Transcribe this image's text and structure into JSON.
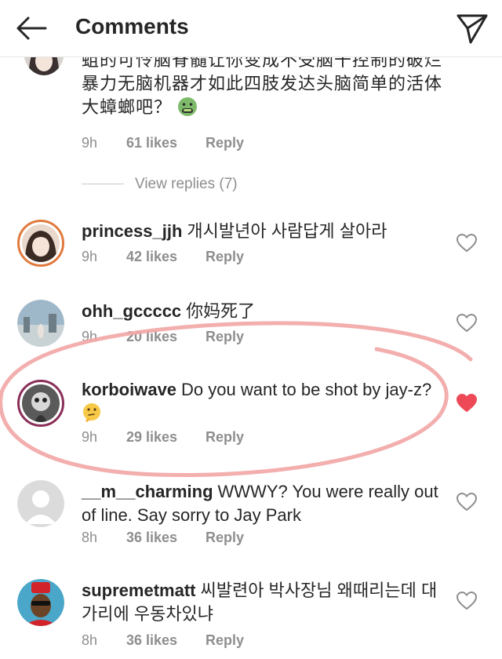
{
  "header": {
    "title": "Comments",
    "back_icon": "arrow-left-icon",
    "send_icon": "paper-plane-icon"
  },
  "comments": [
    {
      "username": "",
      "text": "蛆的可怜脑脊髓让你变成不受脑干控制的破烂暴力无脑机器才如此四肢发达头脑简单的活体大蟑螂吧？",
      "emoji": "vomiting-face",
      "time": "9h",
      "likes": "61 likes",
      "reply": "Reply"
    },
    {
      "username": "princess_jjh",
      "text": "개시발년아 사람답게 살아라",
      "time": "9h",
      "likes": "42 likes",
      "reply": "Reply",
      "liked": false
    },
    {
      "username": "ohh_gccccc",
      "text": "你妈死了",
      "time": "9h",
      "likes": "20 likes",
      "reply": "Reply",
      "liked": false
    },
    {
      "username": "korboiwave",
      "text": "Do you want to be shot by jay-z?",
      "emoji": "thinking-face",
      "time": "9h",
      "likes": "29 likes",
      "reply": "Reply",
      "liked": true
    },
    {
      "username": "__m__charming",
      "text": "WWWY? You were really out of line. Say sorry to Jay Park",
      "time": "8h",
      "likes": "36 likes",
      "reply": "Reply",
      "liked": false
    },
    {
      "username": "supremetmatt",
      "text": "씨발련아 박사장님 왜때리는데 대가리에 우동차있냐",
      "time": "8h",
      "likes": "36 likes",
      "reply": "Reply",
      "liked": false
    }
  ],
  "view_replies": "View replies (7)",
  "colors": {
    "liked_heart": "#ed4956",
    "muted": "#8e8e8e",
    "highlight_circle": "#f2a5a5",
    "story_ring": "#e07a3d"
  }
}
